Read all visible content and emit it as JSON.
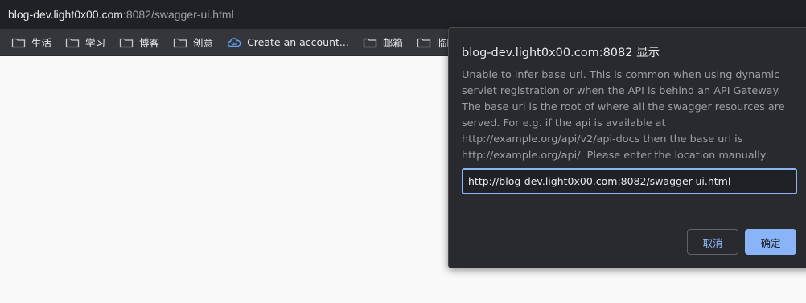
{
  "browser": {
    "url_host": "blog-dev.light0x00.com",
    "url_rest": ":8082/swagger-ui.html"
  },
  "bookmarks": [
    {
      "label": "生活",
      "icon": "folder-icon"
    },
    {
      "label": "学习",
      "icon": "folder-icon"
    },
    {
      "label": "博客",
      "icon": "folder-icon"
    },
    {
      "label": "创意",
      "icon": "folder-icon"
    },
    {
      "label": "Create an account...",
      "icon": "cloud-icon"
    },
    {
      "label": "邮箱",
      "icon": "folder-icon"
    },
    {
      "label": "临时",
      "icon": "folder-icon"
    }
  ],
  "dialog": {
    "title": "blog-dev.light0x00.com:8082 显示",
    "message": "Unable to infer base url. This is common when using dynamic servlet registration or when the API is behind an API Gateway. The base url is the root of where all the swagger resources are served. For e.g. if the api is available at http://example.org/api/v2/api-docs then the base url is http://example.org/api/. Please enter the location manually:",
    "input_value": "http://blog-dev.light0x00.com:8082/swagger-ui.html",
    "cancel_label": "取消",
    "ok_label": "确定"
  },
  "colors": {
    "accent": "#8ab4f8",
    "dialog_bg": "#292a2d",
    "toolbar_bg": "#35363a"
  }
}
